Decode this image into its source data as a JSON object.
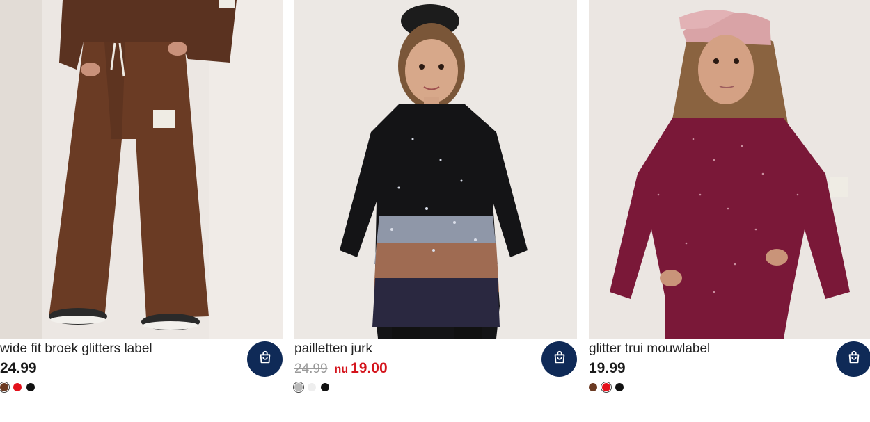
{
  "products": [
    {
      "name": "wide fit broek glitters label",
      "price": "24.99",
      "swatches": [
        {
          "color": "#6b3a22",
          "selected": true
        },
        {
          "color": "#e3111b",
          "selected": false
        },
        {
          "color": "#111111",
          "selected": false
        }
      ]
    },
    {
      "name": "pailletten jurk",
      "old_price": "24.99",
      "now_label": "nu",
      "sale_price": "19.00",
      "swatches": [
        {
          "color": "#b9b9b9",
          "selected": true
        },
        {
          "color": "#eeeeee",
          "selected": false
        },
        {
          "color": "#111111",
          "selected": false
        }
      ]
    },
    {
      "name": "glitter trui mouwlabel",
      "price": "19.99",
      "swatches": [
        {
          "color": "#6b3a22",
          "selected": false
        },
        {
          "color": "#e3111b",
          "selected": true
        },
        {
          "color": "#111111",
          "selected": false
        }
      ]
    }
  ],
  "icons": {
    "cart": "shopping-bag-icon"
  },
  "colors": {
    "cart_button": "#0f2a57",
    "sale_price": "#d4141c",
    "old_price": "#9a9a9a"
  }
}
